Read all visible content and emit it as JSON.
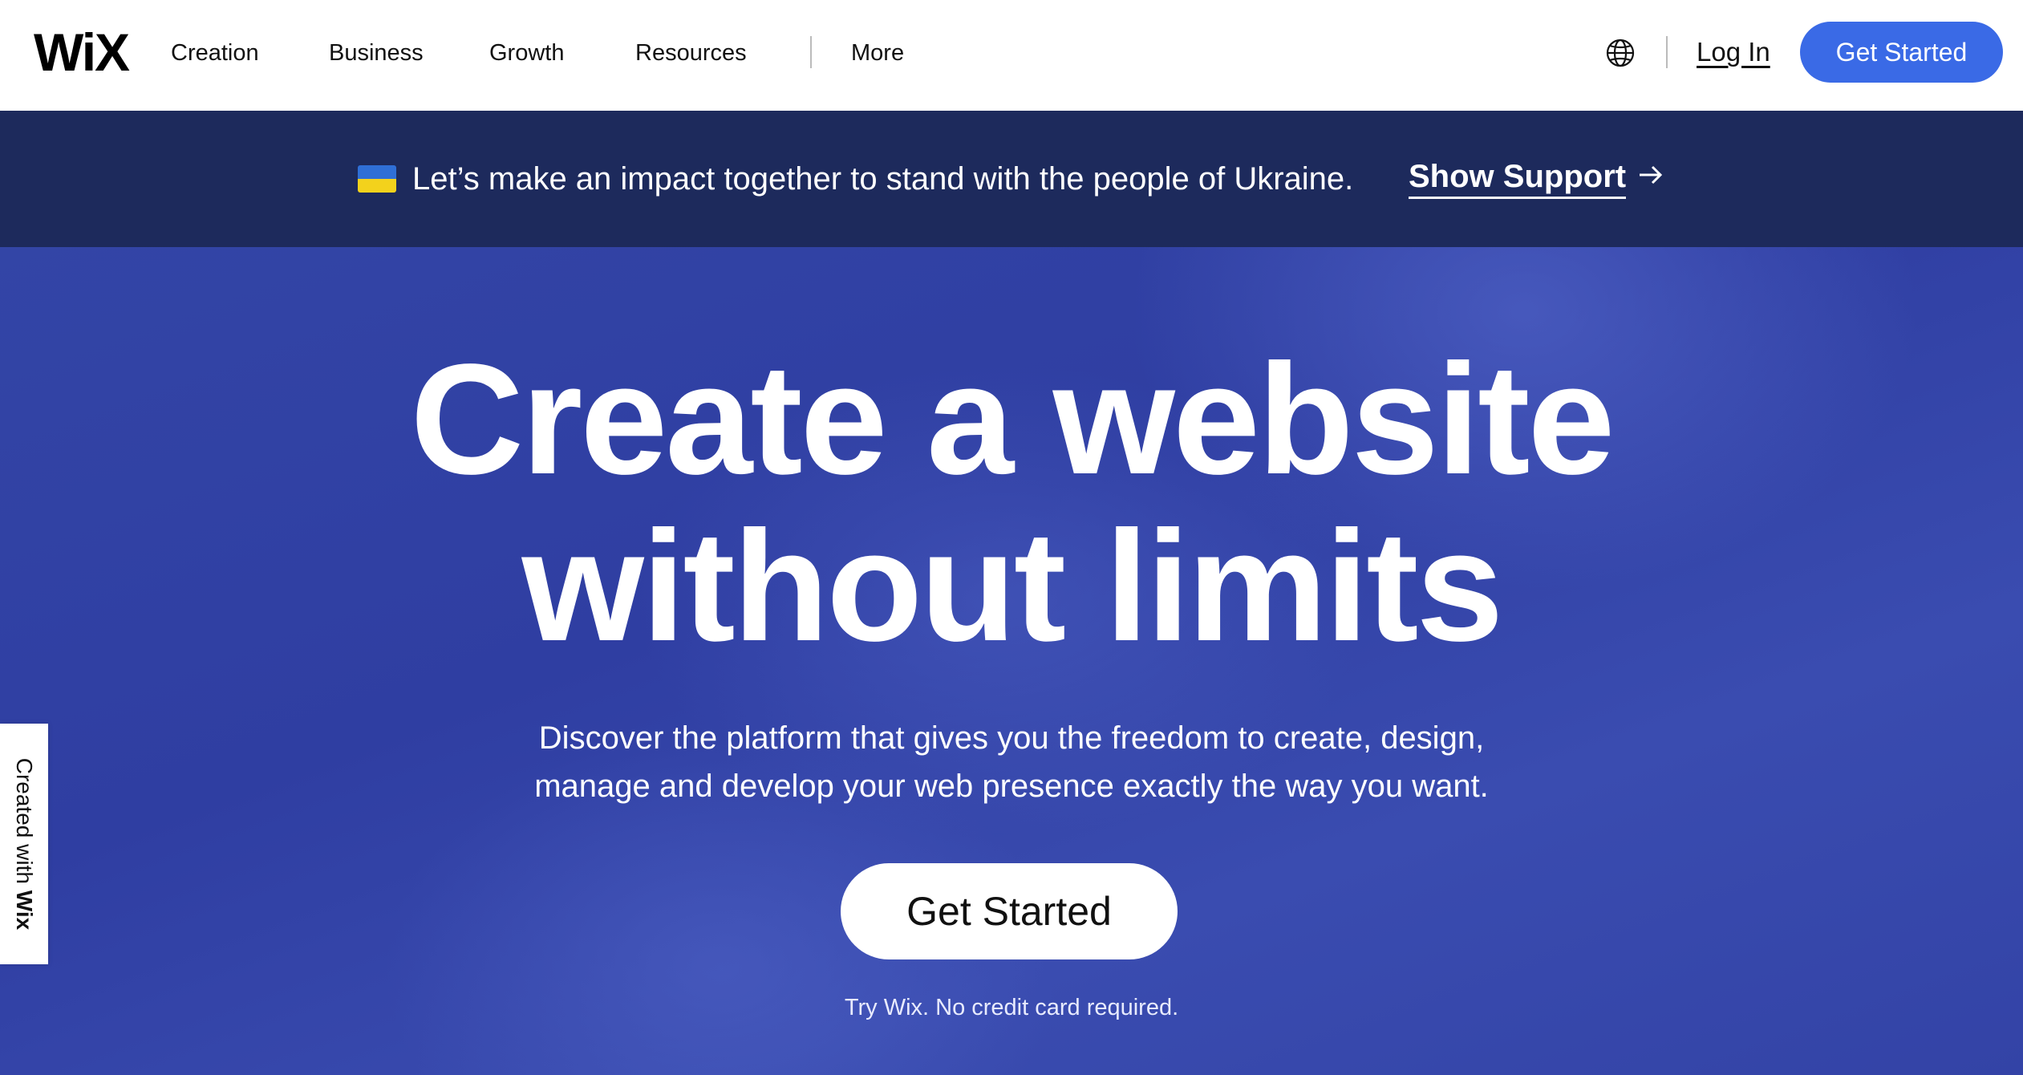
{
  "nav": {
    "logo": "WiX",
    "items": [
      {
        "label": "Creation"
      },
      {
        "label": "Business"
      },
      {
        "label": "Growth"
      },
      {
        "label": "Resources"
      },
      {
        "label": "More"
      }
    ],
    "login": "Log In",
    "cta": "Get Started"
  },
  "banner": {
    "text": "Let’s make an impact together to stand with the people of Ukraine.",
    "link": "Show Support",
    "arrow_icon": "arrow-right-icon"
  },
  "hero": {
    "headline_line1": "Create a website",
    "headline_line2": "without limits",
    "subtext_line1": "Discover the platform that gives you the freedom to create, design,",
    "subtext_line2": "manage and develop your web presence exactly the way you want.",
    "cta": "Get Started",
    "note": "Try Wix. No credit card required."
  },
  "side_tab": {
    "prefix": "Created with",
    "brand": "Wix"
  },
  "colors": {
    "accent": "#3a6ae6",
    "banner_bg": "#1d2a5c",
    "hero_bg": "#3345a6"
  }
}
